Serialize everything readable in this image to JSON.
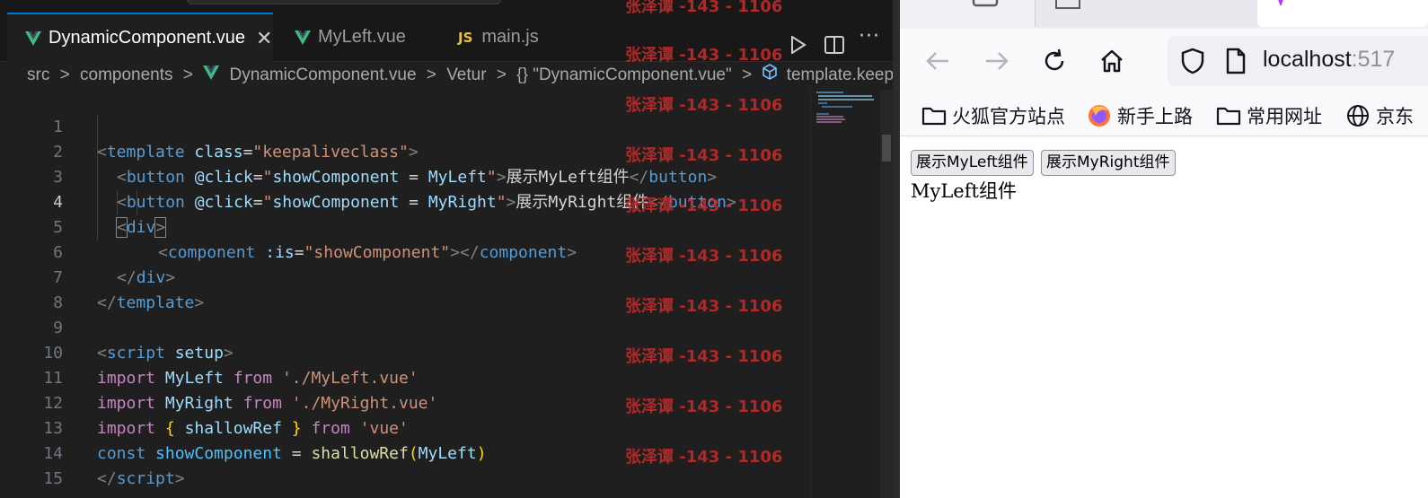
{
  "editor": {
    "tabs": [
      {
        "label": "DynamicComponent.vue",
        "kind": "vue",
        "active": true
      },
      {
        "label": "MyLeft.vue",
        "kind": "vue",
        "active": false
      },
      {
        "label": "main.js",
        "kind": "js",
        "active": false
      }
    ],
    "tab_close_glyph": "✕",
    "js_badge": "JS",
    "breadcrumb": [
      "src",
      "components",
      "DynamicComponent.vue",
      "Vetur",
      "{} \"DynamicComponent.vue\"",
      "template.keepalive"
    ],
    "breadcrumb_sep": ">",
    "line_numbers": [
      "1",
      "2",
      "3",
      "4",
      "5",
      "6",
      "7",
      "8",
      "9",
      "10",
      "11",
      "12",
      "13",
      "14",
      "15"
    ],
    "current_line": "4",
    "code": {
      "l1": {
        "lt": "<",
        "tag": "template",
        "attr": "class",
        "eq": "=",
        "str": "\"keepaliveclass\"",
        "gt": ">"
      },
      "l2": {
        "lt": "<",
        "tag": "button",
        "attr": "@click",
        "eq": "=",
        "q1": "\"",
        "var": "showComponent",
        "op": " = ",
        "val": "MyLeft",
        "q2": "\"",
        "gt": ">",
        "text": "展示MyLeft组件",
        "close_lt": "</",
        "close_tag": "button",
        "close_gt": ">"
      },
      "l3": {
        "lt": "<",
        "tag": "button",
        "attr": "@click",
        "eq": "=",
        "q1": "\"",
        "var": "showComponent",
        "op": " = ",
        "val": "MyRight",
        "q2": "\"",
        "gt": ">",
        "text": "展示MyRight组件",
        "close_lt": "</",
        "close_tag": "button",
        "close_gt": ">"
      },
      "l4": {
        "lt": "<",
        "tag": "div",
        "gt": ">"
      },
      "l5": {
        "lt": "<",
        "tag": "component",
        "attr": ":is",
        "eq": "=",
        "str": "\"showComponent\"",
        "gt": ">",
        "close_lt": "</",
        "close_tag": "component",
        "close_gt": ">"
      },
      "l6": {
        "lt": "</",
        "tag": "div",
        "gt": ">"
      },
      "l7": {
        "lt": "</",
        "tag": "template",
        "gt": ">"
      },
      "l9": {
        "lt": "<",
        "tag": "script",
        "attr": "setup",
        "gt": ">"
      },
      "l10": {
        "kw": "import",
        "name": "MyLeft",
        "from": "from",
        "str": "'./MyLeft.vue'"
      },
      "l11": {
        "kw": "import",
        "name": "MyRight",
        "from": "from",
        "str": "'./MyRight.vue'"
      },
      "l12": {
        "kw": "import",
        "lb": "{",
        "name": "shallowRef",
        "rb": "}",
        "from": "from",
        "str": "'vue'"
      },
      "l13": {
        "kw": "const",
        "name": "showComponent",
        "op": " = ",
        "fn": "shallowRef",
        "lp": "(",
        "arg": "MyLeft",
        "rp": ")"
      },
      "l14": {
        "lt": "</",
        "tag": "script",
        "gt": ">"
      }
    },
    "watermark": "张泽谭 -143 - 1106",
    "actions": {
      "run_icon": "play-icon",
      "split_icon": "split-editor-icon",
      "more": "···"
    }
  },
  "browser": {
    "url_host": "localhost",
    "url_port": ":517",
    "bookmarks": [
      "火狐官方站点",
      "新手上路",
      "常用网址",
      "京东"
    ],
    "page": {
      "buttons": [
        "展示MyLeft组件",
        "展示MyRight组件"
      ],
      "content": "MyLeft组件"
    }
  },
  "colors": {
    "editor_bg": "#1f1f1f",
    "accent": "#0078d4",
    "watermark": "#c12a2a",
    "vue_green": "#41b883"
  }
}
